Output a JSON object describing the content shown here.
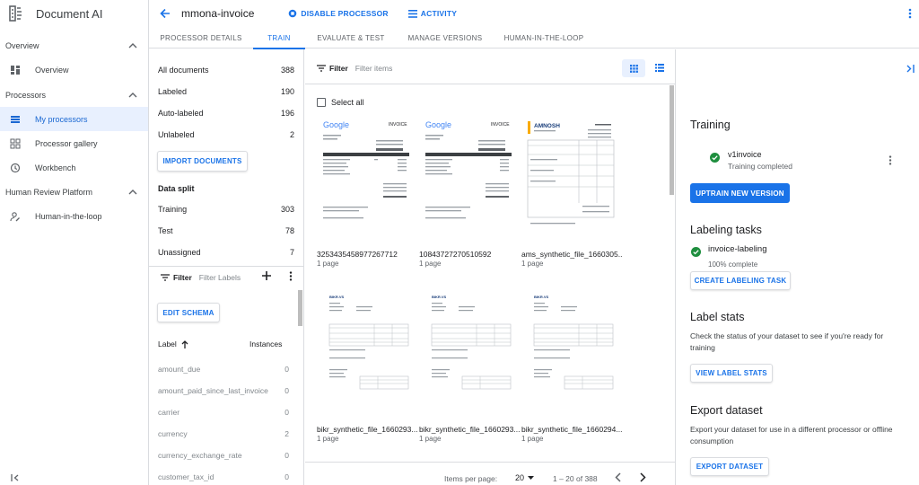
{
  "app": {
    "title": "Document AI"
  },
  "nav": {
    "overview_section": "Overview",
    "overview_item": "Overview",
    "processors_section": "Processors",
    "my_processors": "My processors",
    "processor_gallery": "Processor gallery",
    "workbench": "Workbench",
    "hrp_section": "Human Review Platform",
    "hitl": "Human-in-the-loop"
  },
  "header": {
    "processor_name": "mmona-invoice",
    "disable_label": "DISABLE PROCESSOR",
    "activity_label": "ACTIVITY"
  },
  "tabs": [
    {
      "label": "PROCESSOR DETAILS"
    },
    {
      "label": "TRAIN"
    },
    {
      "label": "EVALUATE & TEST"
    },
    {
      "label": "MANAGE VERSIONS"
    },
    {
      "label": "HUMAN-IN-THE-LOOP"
    }
  ],
  "documents": {
    "all_label": "All documents",
    "all_count": "388",
    "labeled_label": "Labeled",
    "labeled_count": "190",
    "auto_label": "Auto-labeled",
    "auto_count": "196",
    "unlabeled_label": "Unlabeled",
    "unlabeled_count": "2",
    "import_button": "IMPORT DOCUMENTS"
  },
  "split": {
    "title": "Data split",
    "training_label": "Training",
    "training_count": "303",
    "test_label": "Test",
    "test_count": "78",
    "unassigned_label": "Unassigned",
    "unassigned_count": "7"
  },
  "labels": {
    "filter_label": "Filter",
    "filter_placeholder": "Filter Labels",
    "edit_schema": "EDIT SCHEMA",
    "col_label": "Label",
    "col_instances": "Instances",
    "rows": [
      {
        "name": "amount_due",
        "count": "0"
      },
      {
        "name": "amount_paid_since_last_invoice",
        "count": "0"
      },
      {
        "name": "carrier",
        "count": "0"
      },
      {
        "name": "currency",
        "count": "2"
      },
      {
        "name": "currency_exchange_rate",
        "count": "0"
      },
      {
        "name": "customer_tax_id",
        "count": "0"
      }
    ]
  },
  "grid": {
    "filter_label": "Filter",
    "filter_placeholder": "Filter items",
    "select_all": "Select all",
    "items": [
      {
        "name": "3253435458977267712",
        "pages": "1 page",
        "kind": "google"
      },
      {
        "name": "10843727270510592",
        "pages": "1 page",
        "kind": "google"
      },
      {
        "name": "ams_synthetic_file_1660305...",
        "pages": "1 page",
        "kind": "amnosh"
      },
      {
        "name": "bikr_synthetic_file_1660293...",
        "pages": "1 page",
        "kind": "bikr"
      },
      {
        "name": "bikr_synthetic_file_1660293...",
        "pages": "1 page",
        "kind": "bikr"
      },
      {
        "name": "bikr_synthetic_file_1660294...",
        "pages": "1 page",
        "kind": "bikr"
      }
    ],
    "thumb_text": {
      "google": "Google",
      "invoice": "INVOICE",
      "amnosh": "AMNOSH",
      "bikr": "BIKR.VS"
    }
  },
  "pagination": {
    "items_per_page_label": "Items per page:",
    "items_per_page": "20",
    "range": "1 – 20 of 388"
  },
  "right": {
    "training_title": "Training",
    "version_name": "v1invoice",
    "version_status": "Training completed",
    "uptrain_button": "UPTRAIN NEW VERSION",
    "labeling_title": "Labeling tasks",
    "task_name": "invoice-labeling",
    "task_status": "100% complete",
    "create_task_button": "CREATE LABELING TASK",
    "stats_title": "Label stats",
    "stats_text": "Check the status of your dataset to see if you're ready for training",
    "stats_button": "VIEW LABEL STATS",
    "export_title": "Export dataset",
    "export_text": "Export your dataset for use in a different processor or offline consumption",
    "export_button": "EXPORT DATASET"
  },
  "colors": {
    "accent": "#1a73e8",
    "success": "#1e8e3e",
    "nav_active_bg": "#e8f0fe"
  }
}
